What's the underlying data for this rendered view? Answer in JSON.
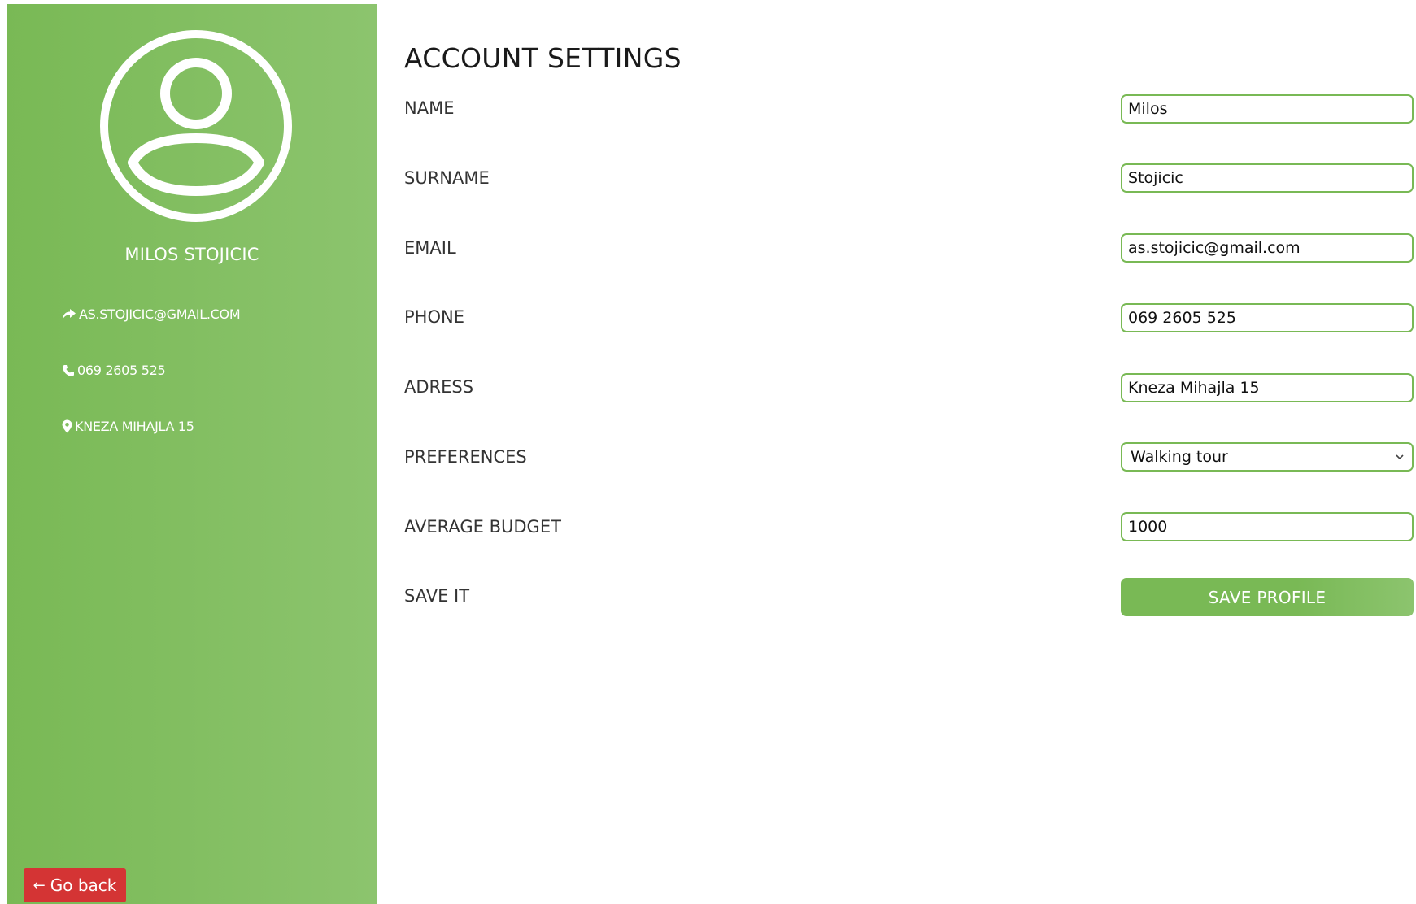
{
  "colors": {
    "accent": "#79b955",
    "accent_light": "#8cc46e",
    "back_button": "#d43434"
  },
  "profile": {
    "name": "MILOS STOJICIC",
    "email": "AS.STOJICIC@GMAIL.COM",
    "phone": "069 2605 525",
    "address": "KNEZA MIHAJLA 15",
    "icons": {
      "avatar": "user-circle-icon",
      "email": "share-arrow-icon",
      "phone": "phone-icon",
      "address": "map-marker-icon"
    }
  },
  "navigation": {
    "back_label": "Go back",
    "back_arrow": "←"
  },
  "form": {
    "title": "ACCOUNT SETTINGS",
    "fields": {
      "name": {
        "label": "NAME",
        "value": "Milos"
      },
      "surname": {
        "label": "SURNAME",
        "value": "Stojicic"
      },
      "email": {
        "label": "EMAIL",
        "value": "as.stojicic@gmail.com"
      },
      "phone": {
        "label": "PHONE",
        "value": "069 2605 525"
      },
      "address": {
        "label": "ADRESS",
        "value": "Kneza Mihajla 15"
      },
      "preferences": {
        "label": "PREFERENCES",
        "value": "Walking tour"
      },
      "budget": {
        "label": "AVERAGE BUDGET",
        "value": "1000"
      }
    },
    "save": {
      "label": "SAVE IT",
      "button": "SAVE PROFILE"
    }
  }
}
